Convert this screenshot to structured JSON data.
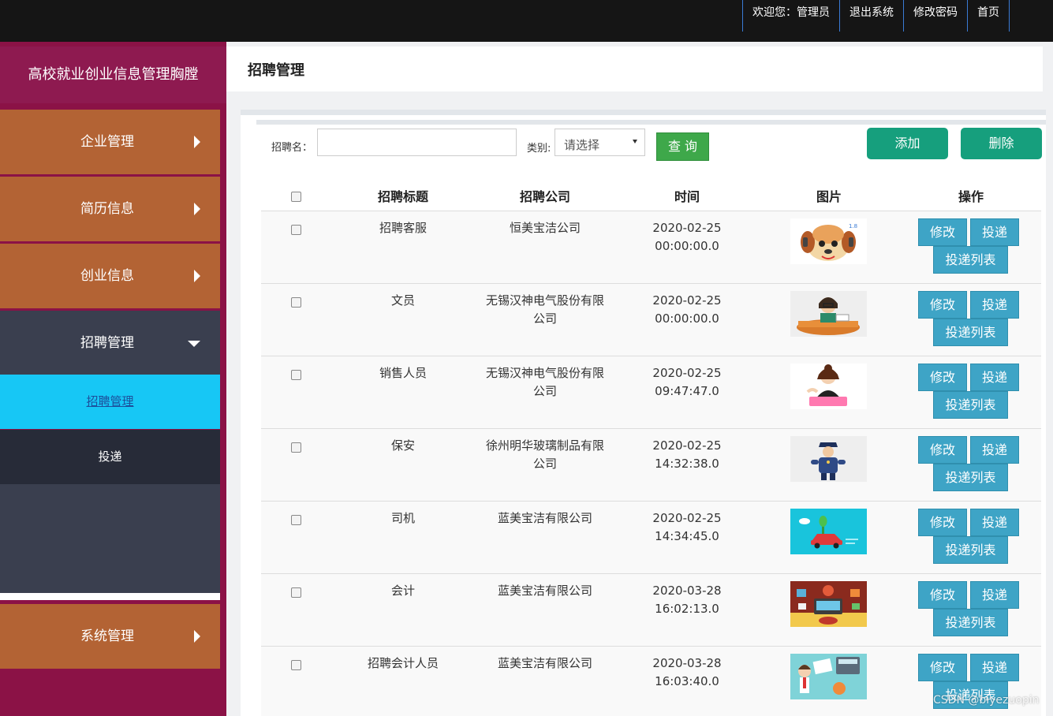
{
  "topnav": {
    "welcome": "欢迎您：管理员",
    "logout": "退出系统",
    "change_password": "修改密码",
    "home": "首页"
  },
  "sidebar": {
    "brand": "高校就业创业信息管理胸膛",
    "items": [
      {
        "label": "企业管理"
      },
      {
        "label": "简历信息"
      },
      {
        "label": "创业信息"
      },
      {
        "label": "招聘管理"
      },
      {
        "label": "系统管理"
      }
    ],
    "subitems": [
      {
        "label": "招聘管理"
      },
      {
        "label": "投递"
      }
    ]
  },
  "page": {
    "title": "招聘管理"
  },
  "search": {
    "name_label": "招聘名：",
    "name_value": "",
    "category_label": "类别:",
    "category_selected": "请选择",
    "query_button": "查 询",
    "add_button": "添加",
    "delete_button": "删除"
  },
  "table": {
    "headers": [
      "招聘标题",
      "招聘公司",
      "时间",
      "图片",
      "操作"
    ],
    "rows": [
      {
        "title": "招聘客服",
        "company_l1": "恒美宝洁公司",
        "company_l2": "",
        "date": "2020-02-25",
        "time": "00:00:00.0"
      },
      {
        "title": "文员",
        "company_l1": "无锡汉神电气股份有限",
        "company_l2": "公司",
        "date": "2020-02-25",
        "time": "00:00:00.0"
      },
      {
        "title": "销售人员",
        "company_l1": "无锡汉神电气股份有限",
        "company_l2": "公司",
        "date": "2020-02-25",
        "time": "09:47:47.0"
      },
      {
        "title": "保安",
        "company_l1": "徐州明华玻璃制品有限",
        "company_l2": "公司",
        "date": "2020-02-25",
        "time": "14:32:38.0"
      },
      {
        "title": "司机",
        "company_l1": "蓝美宝洁有限公司",
        "company_l2": "",
        "date": "2020-02-25",
        "time": "14:34:45.0"
      },
      {
        "title": "会计",
        "company_l1": "蓝美宝洁有限公司",
        "company_l2": "",
        "date": "2020-03-28",
        "time": "16:02:13.0"
      },
      {
        "title": "招聘会计人员",
        "company_l1": "蓝美宝洁有限公司",
        "company_l2": "",
        "date": "2020-03-28",
        "time": "16:03:40.0"
      }
    ],
    "actions": {
      "edit": "修改",
      "deliver": "投递",
      "deliver_list": "投递列表"
    }
  },
  "watermark": "CSDN @biyezuopin",
  "colors": {
    "topbar": "#151515",
    "sidebar": "#8b1246",
    "menu_item": "#b36334",
    "menu_open": "#3a3f4f",
    "submenu_active": "#17c7f5",
    "green_button": "#169f7d",
    "query_button": "#3ea84a",
    "op_button": "#3ea4c6"
  }
}
